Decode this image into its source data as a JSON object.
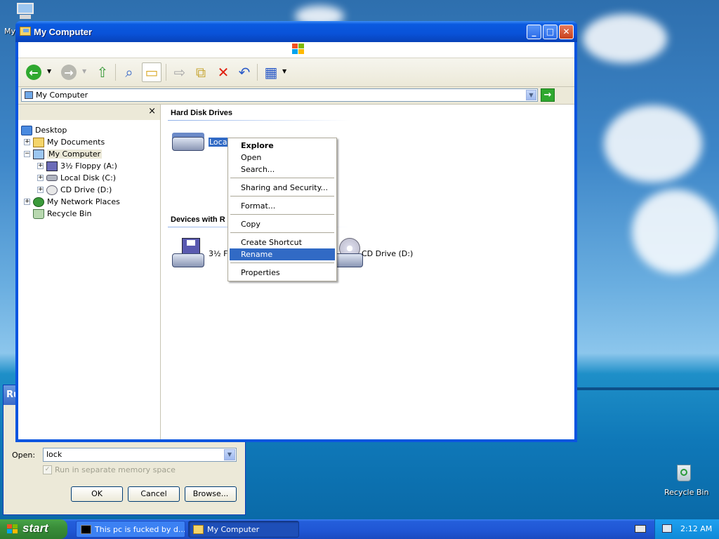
{
  "desktop": {
    "icon_my_computer_label": "My",
    "icon_recycle_bin_label": "Recycle Bin"
  },
  "window": {
    "title": "My Computer",
    "buttons": {
      "minimize": "_",
      "maximize": "□",
      "close": "✕"
    }
  },
  "address": {
    "value": "My Computer",
    "go": "→"
  },
  "folders_pane": {
    "close": "×",
    "tree": [
      {
        "label": "Desktop"
      },
      {
        "label": "My Documents",
        "toggle": "+"
      },
      {
        "label": "My Computer",
        "toggle": "−"
      },
      {
        "label": "3½ Floppy (A:)",
        "toggle": "+"
      },
      {
        "label": "Local Disk (C:)",
        "toggle": "+"
      },
      {
        "label": "CD Drive (D:)",
        "toggle": "+"
      },
      {
        "label": "My Network Places",
        "toggle": "+"
      },
      {
        "label": "Recycle Bin"
      }
    ]
  },
  "content": {
    "groups": [
      {
        "title": "Hard Disk Drives"
      },
      {
        "title": "Devices with R"
      }
    ],
    "items": {
      "local_disk": "Local",
      "floppy": "3½ F",
      "cd": "CD Drive (D:)"
    }
  },
  "context_menu": {
    "items": [
      {
        "label": "Explore"
      },
      {
        "label": "Open"
      },
      {
        "label": "Search..."
      },
      {
        "label": "Sharing and Security..."
      },
      {
        "label": "Format..."
      },
      {
        "label": "Copy"
      },
      {
        "label": "Create Shortcut"
      },
      {
        "label": "Rename"
      },
      {
        "label": "Properties"
      }
    ]
  },
  "run_dialog": {
    "title": "Ru",
    "open_label": "Open:",
    "input_value": "lock",
    "checkbox_label": "Run in separate memory space",
    "ok": "OK",
    "cancel": "Cancel",
    "browse": "Browse..."
  },
  "taskbar": {
    "start": "start",
    "tasks": [
      {
        "label": "This pc is fucked by d..."
      },
      {
        "label": "My Computer"
      }
    ],
    "clock": "2:12 AM"
  },
  "colors": {
    "titlebar": "#0a5ae0",
    "selection": "#316ac5",
    "taskbar": "#245edb",
    "start_button": "#3a8e3a"
  }
}
